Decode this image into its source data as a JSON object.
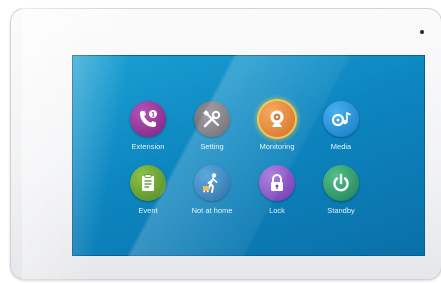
{
  "apps": [
    {
      "label": "Extension",
      "icon": "phone-icon",
      "color": "#8b2e8f"
    },
    {
      "label": "Setting",
      "icon": "tools-icon",
      "color": "#6c6c72"
    },
    {
      "label": "Monitoring",
      "icon": "webcam-icon",
      "color": "#e0761c"
    },
    {
      "label": "Media",
      "icon": "media-icon",
      "color": "#1e8fd8"
    },
    {
      "label": "Event",
      "icon": "clipboard-icon",
      "color": "#6aa52b"
    },
    {
      "label": "Not at home",
      "icon": "walking-person-icon",
      "color": "#1f77b8"
    },
    {
      "label": "Lock",
      "icon": "padlock-icon",
      "color": "#8a4fc6"
    },
    {
      "label": "Standby",
      "icon": "power-icon",
      "color": "#2d9d6a"
    }
  ],
  "refresh": {
    "icon": "refresh-icon",
    "color": "#1a8ed1"
  }
}
